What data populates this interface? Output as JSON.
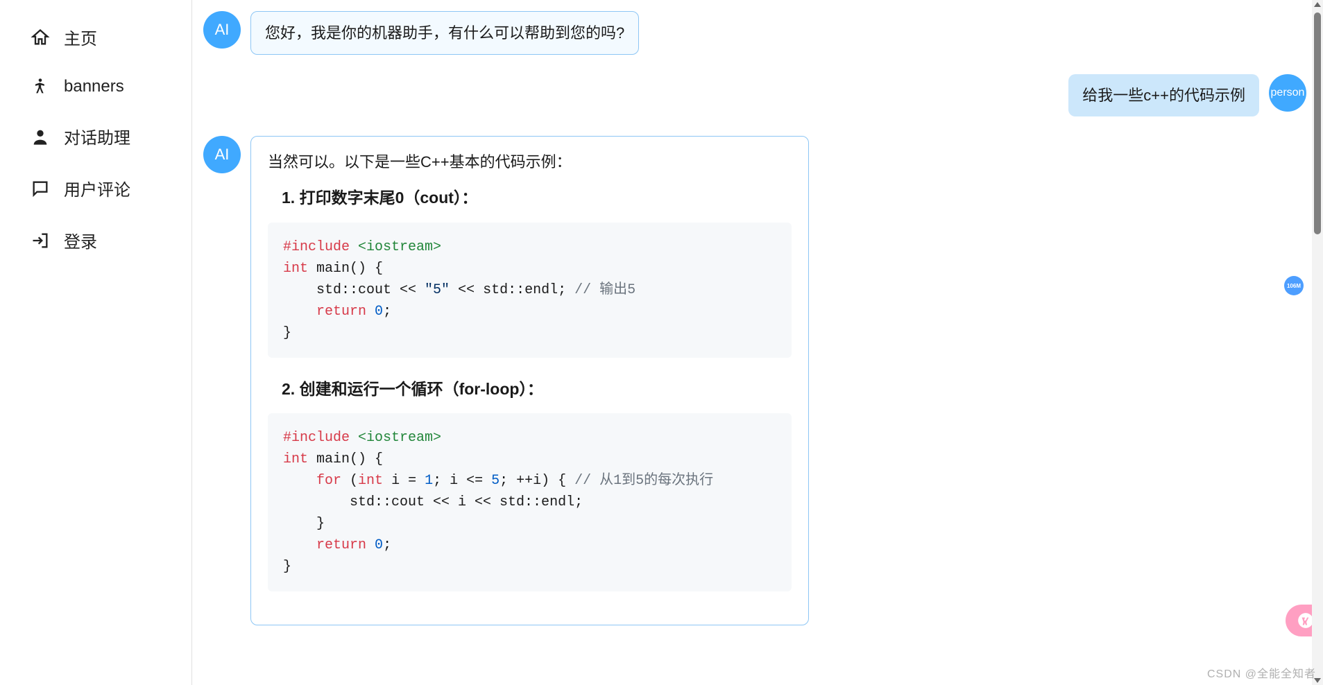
{
  "sidebar": {
    "items": [
      {
        "label": "主页",
        "icon": "home-icon"
      },
      {
        "label": "banners",
        "icon": "accessibility-icon"
      },
      {
        "label": "对话助理",
        "icon": "person-icon"
      },
      {
        "label": "用户评论",
        "icon": "comment-icon"
      },
      {
        "label": "登录",
        "icon": "login-icon"
      }
    ]
  },
  "chat": {
    "ai_avatar": "AI",
    "user_avatar": "person",
    "messages": {
      "ai_greeting": "您好，我是你的机器助手，有什么可以帮助到您的吗?",
      "user_request": "给我一些c++的代码示例",
      "ai_intro": "当然可以。以下是一些C++基本的代码示例：",
      "section1_title": "1. 打印数字末尾0（cout）：",
      "code1": {
        "l1_kw": "#include",
        "l1_lib": "<iostream>",
        "l2_kw": "int",
        "l2_rest": " main() {",
        "l3_pre": "    std::cout << ",
        "l3_str": "\"5\"",
        "l3_post": " << std::endl; ",
        "l3_cmt": "// 输出5",
        "l4_pre": "    ",
        "l4_kw": "return",
        "l4_sp": " ",
        "l4_num": "0",
        "l4_post": ";",
        "l5": "}"
      },
      "section2_title": "2. 创建和运行一个循环（for-loop）：",
      "code2": {
        "l1_kw": "#include",
        "l1_lib": "<iostream>",
        "l2_kw": "int",
        "l2_rest": " main() {",
        "l3_pre": "    ",
        "l3_kw1": "for",
        "l3_mid1": " (",
        "l3_kw2": "int",
        "l3_mid2": " i = ",
        "l3_num1": "1",
        "l3_mid3": "; i <= ",
        "l3_num2": "5",
        "l3_mid4": "; ++i) { ",
        "l3_cmt": "// 从1到5的每次执行",
        "l4": "        std::cout << i << std::endl;",
        "l5": "    }",
        "l6_pre": "    ",
        "l6_kw": "return",
        "l6_sp": " ",
        "l6_num": "0",
        "l6_post": ";",
        "l7": "}"
      }
    }
  },
  "float_badge": "106M",
  "watermark": "CSDN @全能全知者"
}
